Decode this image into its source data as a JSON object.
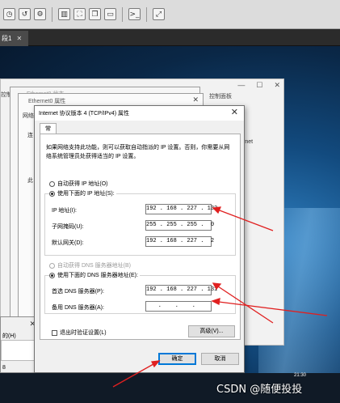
{
  "vm": {
    "tab_label": "段1",
    "tab_close": "✕"
  },
  "background": {
    "left_text": "控制",
    "right_text": "控制面板",
    "net_text": "rnet",
    "window2_title": "Ethernet0 状态",
    "window3_title": "Ethernet0 属性",
    "side_label_1": "网络",
    "side_label_2": "连",
    "side_label_3": "此"
  },
  "small_dialog": {
    "label": "的(H)",
    "number": "8"
  },
  "dialog": {
    "title": "Internet 协议版本 4 (TCP/IPv4) 属性",
    "tab": "常规",
    "description": "如果网络支持此功能，则可以获取自动指派的 IP 设置。否则，你需要从网络系统管理员处获得适当的 IP 设置。",
    "auto_ip_label": "自动获得 IP 地址(O)",
    "manual_ip_label": "使用下面的 IP 地址(S):",
    "ip_label": "IP 地址(I):",
    "ip_value": "192 . 168 . 227 . 132",
    "mask_label": "子网掩码(U):",
    "mask_value": "255 . 255 . 255 .  0",
    "gateway_label": "默认网关(D):",
    "gateway_value": "192 . 168 . 227 .  2",
    "auto_dns_label": "自动获得 DNS 服务器地址(B)",
    "manual_dns_label": "使用下面的 DNS 服务器地址(E):",
    "dns1_label": "首选 DNS 服务器(P):",
    "dns1_value": "192 . 168 . 227 . 131",
    "dns2_label": "备用 DNS 服务器(A):",
    "dns2_value": "  .    .    .   ",
    "validate_label": "退出时验证设置(L)",
    "advanced_button": "高级(V)...",
    "ok_button": "确定",
    "cancel_button": "取消"
  },
  "taskbar": {
    "time": "21:30"
  },
  "watermark": "CSDN @随便投投",
  "colors": {
    "arrow": "#e02020",
    "primary_border": "#0078d7"
  }
}
